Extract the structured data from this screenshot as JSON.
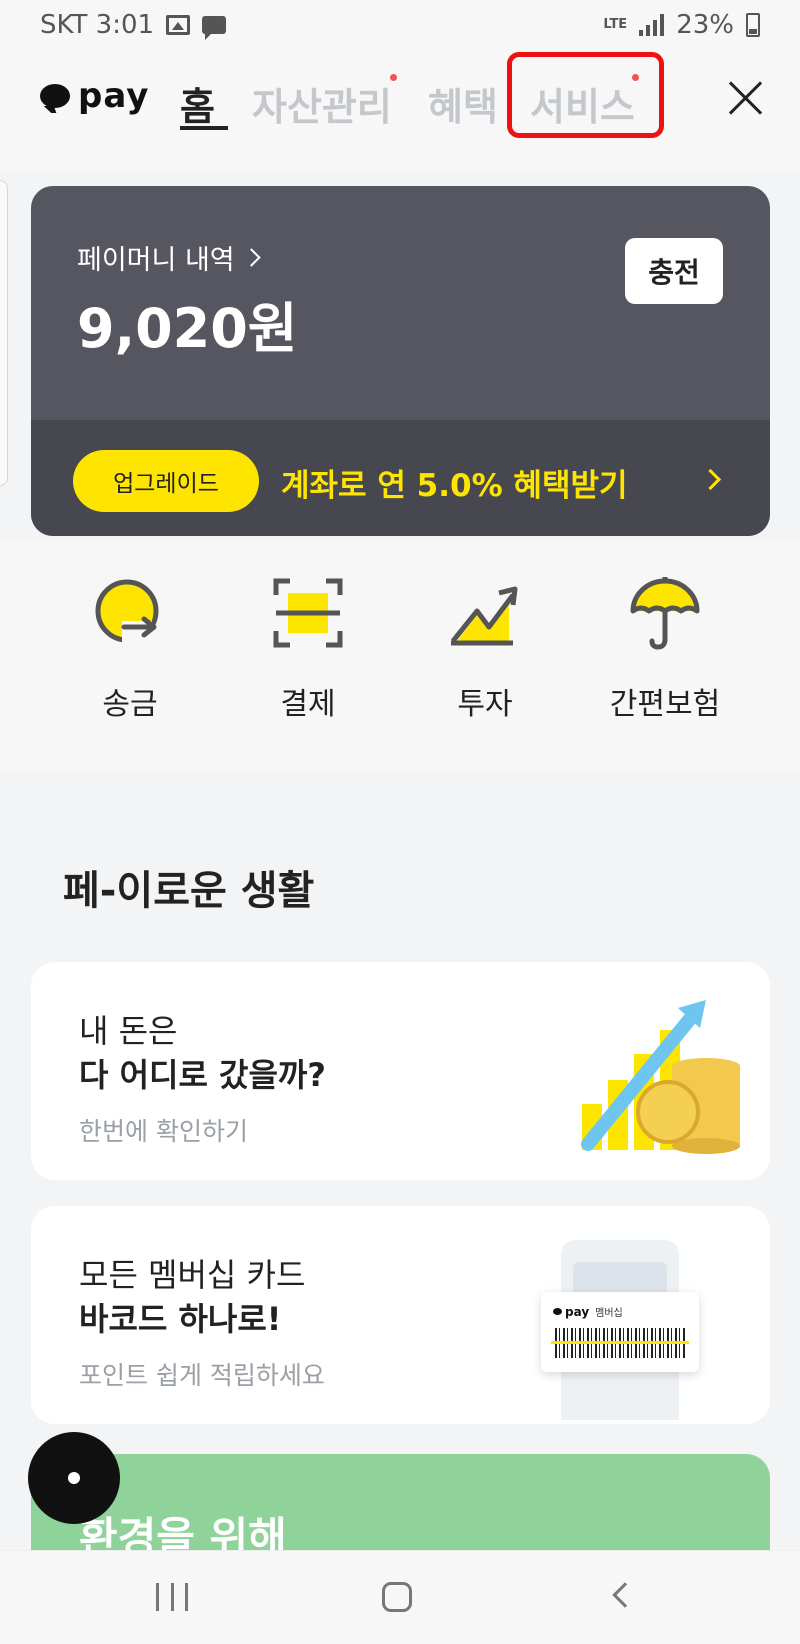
{
  "status_bar": {
    "carrier_time": "SKT 3:01",
    "network": "LTE",
    "battery": "23%"
  },
  "header": {
    "logo_text": "pay",
    "tabs": [
      {
        "label": "홈"
      },
      {
        "label": "자산관리"
      },
      {
        "label": "혜택"
      },
      {
        "label": "서비스"
      }
    ]
  },
  "balance": {
    "label": "페이머니 내역",
    "amount": "9,020원",
    "charge_label": "충전"
  },
  "upgrade": {
    "badge": "업그레이드",
    "text": "계좌로 연 5.0% 혜택받기"
  },
  "quick_menu": [
    {
      "label": "송금",
      "icon": "send-money-icon"
    },
    {
      "label": "결제",
      "icon": "payment-scan-icon"
    },
    {
      "label": "투자",
      "icon": "invest-chart-icon"
    },
    {
      "label": "간편보험",
      "icon": "umbrella-icon"
    }
  ],
  "section": {
    "title": "페-이로운 생활"
  },
  "cards": [
    {
      "line1": "내 돈은",
      "line2": "다 어디로 갔을까?",
      "sub": "한번에 확인하기"
    },
    {
      "line1": "모든 멤버십 카드",
      "line2": "바코드 하나로!",
      "sub": "포인트 쉽게 적립하세요",
      "graphic_logo": "pay",
      "graphic_label": "멤버십"
    }
  ],
  "eco": {
    "title": "환경을 위해"
  },
  "colors": {
    "accent_yellow": "#fee500",
    "card_dark": "#555660",
    "eco_green": "#8fd39a",
    "highlight_red": "#ee1111"
  }
}
